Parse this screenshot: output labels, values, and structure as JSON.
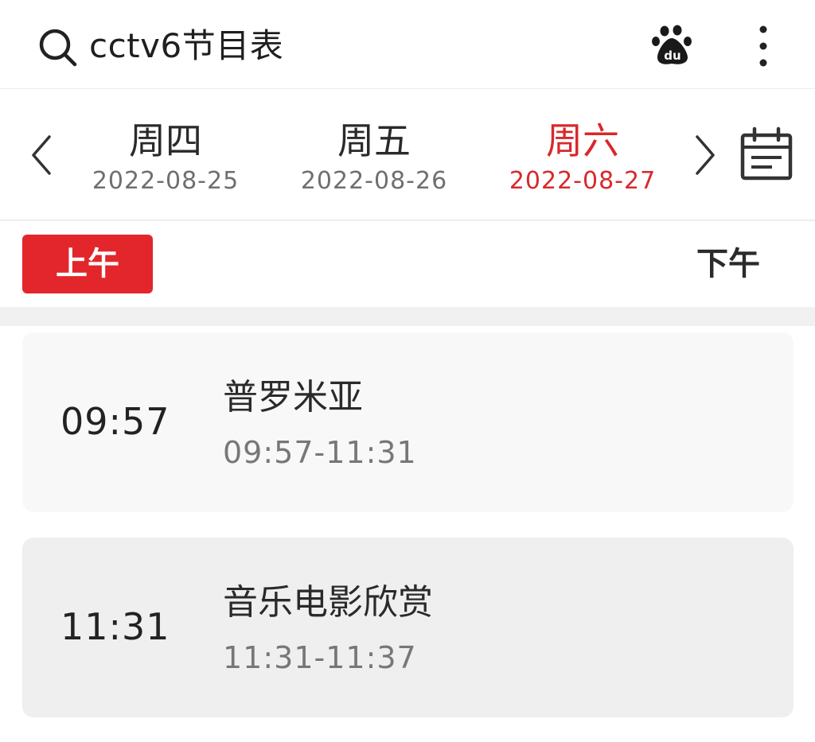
{
  "search": {
    "query": "cctv6节目表"
  },
  "icons": {
    "search": "search-icon",
    "baidu": "baidu-paw-icon",
    "more": "more-vertical-icon",
    "prev": "chevron-left-icon",
    "next": "chevron-right-icon",
    "calendar": "calendar-icon"
  },
  "baidu": {
    "label": "du"
  },
  "dates": [
    {
      "weekday": "周四",
      "date": "2022-08-25",
      "active": false
    },
    {
      "weekday": "周五",
      "date": "2022-08-26",
      "active": false
    },
    {
      "weekday": "周六",
      "date": "2022-08-27",
      "active": true
    }
  ],
  "period": {
    "am": "上午",
    "pm": "下午",
    "selected": "am"
  },
  "programs": [
    {
      "start": "09:57",
      "title": "普罗米亚",
      "range": "09:57-11:31"
    },
    {
      "start": "11:31",
      "title": "音乐电影欣赏",
      "range": "11:31-11:37"
    }
  ],
  "colors": {
    "accent": "#e3262b",
    "active_text": "#d8282c"
  }
}
